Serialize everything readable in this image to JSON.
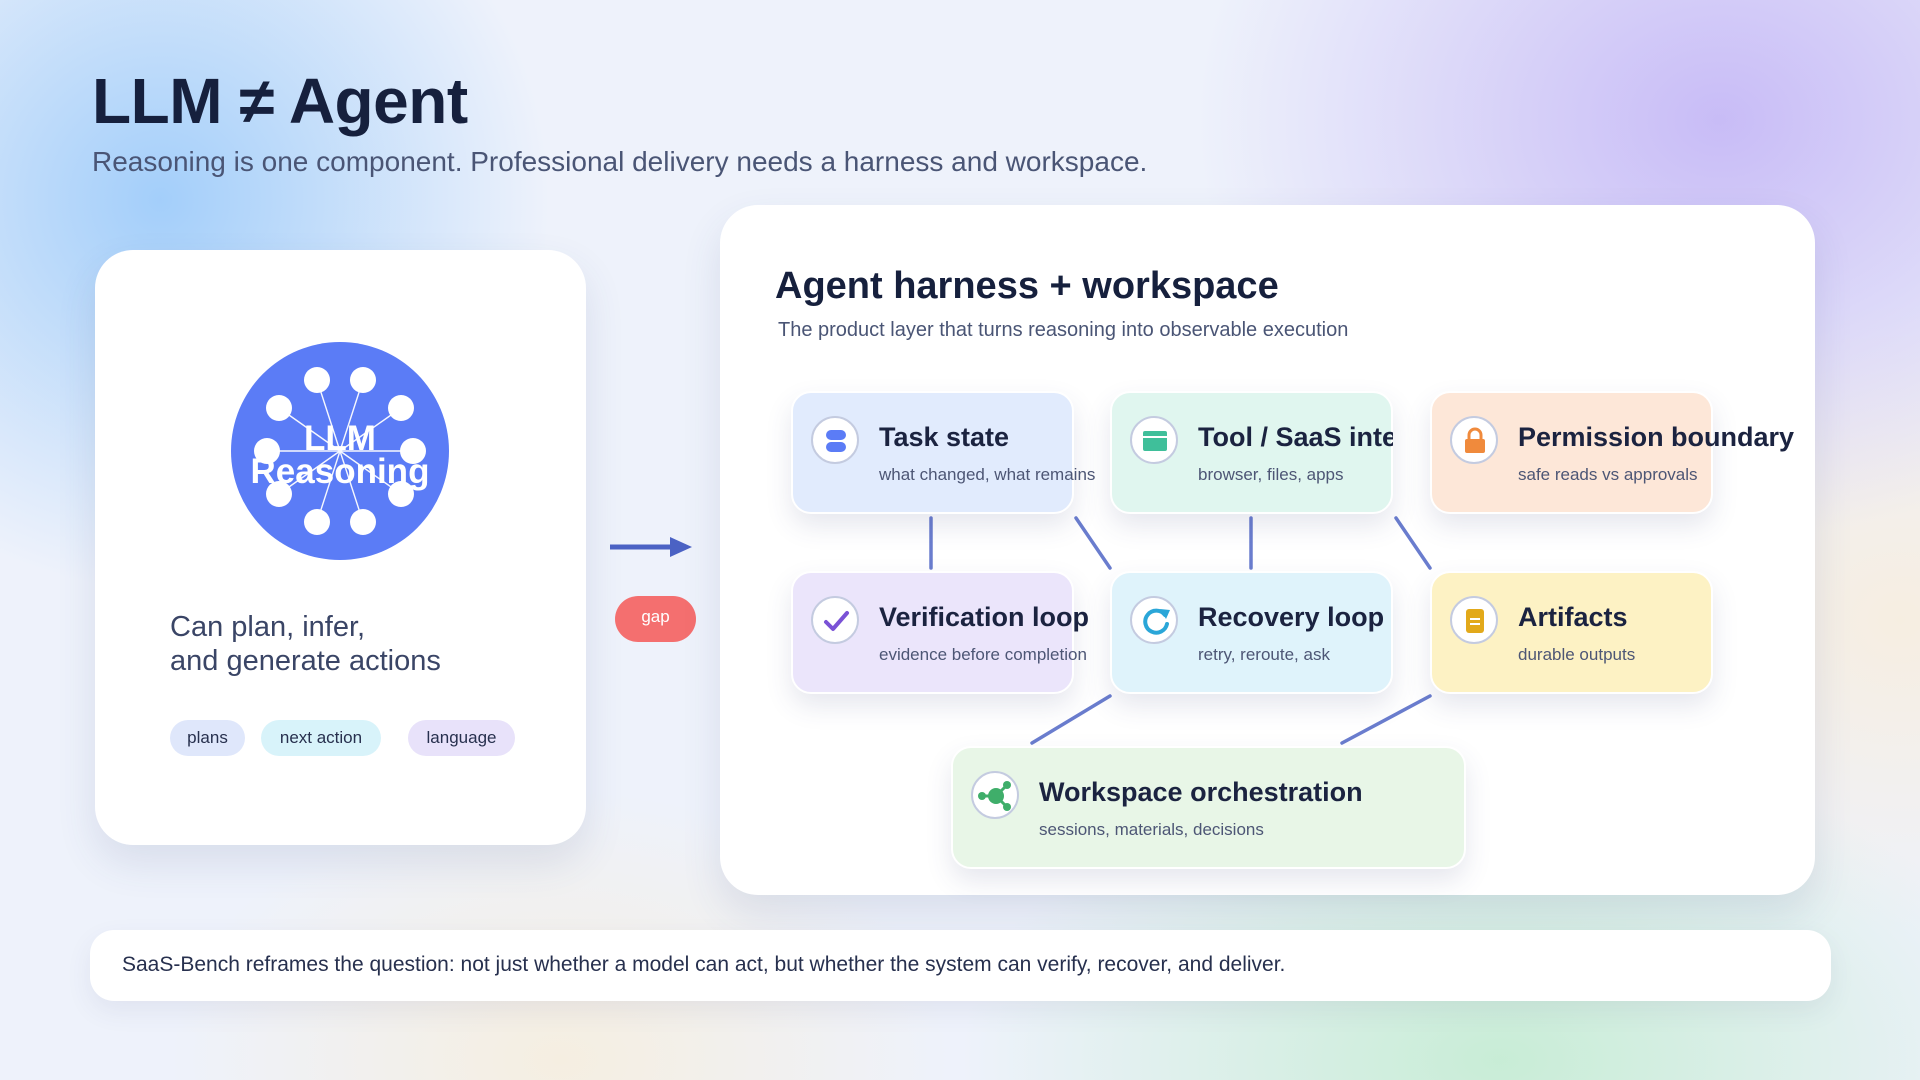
{
  "header": {
    "title": "LLM ≠ Agent",
    "subtitle": "Reasoning is one component. Professional delivery needs a harness and workspace."
  },
  "llm_panel": {
    "circle_label_line1": "LLM",
    "circle_label_line2": "Reasoning",
    "description_line1": "Can plan, infer,",
    "description_line2": "and generate actions",
    "chips": [
      "plans",
      "next action",
      "language"
    ]
  },
  "bridge": {
    "gap_label": "gap"
  },
  "harness_panel": {
    "title": "Agent harness + workspace",
    "subtitle": "The product layer that turns reasoning into observable execution",
    "nodes": [
      {
        "title": "Task state",
        "subtitle": "what changed, what remains",
        "icon": "database-icon",
        "color": "#e1ebfd"
      },
      {
        "title": "Tool / SaaS interface",
        "subtitle": "browser, files, apps",
        "icon": "browser-window-icon",
        "color": "#e0f6ef"
      },
      {
        "title": "Permission boundary",
        "subtitle": "safe reads vs approvals",
        "icon": "lock-icon",
        "color": "#fde7d8"
      },
      {
        "title": "Verification loop",
        "subtitle": "evidence before completion",
        "icon": "checkmark-icon",
        "color": "#ebe5fb"
      },
      {
        "title": "Recovery loop",
        "subtitle": "retry, reroute, ask",
        "icon": "refresh-icon",
        "color": "#dff3fb"
      },
      {
        "title": "Artifacts",
        "subtitle": "durable outputs",
        "icon": "document-icon",
        "color": "#fdf2c4"
      },
      {
        "title": "Workspace orchestration",
        "subtitle": "sessions, materials, decisions",
        "icon": "hub-icon",
        "color": "#e8f6e7"
      }
    ]
  },
  "footer": {
    "text": "SaaS-Bench reframes the question: not just whether a model can act, but whether the system can verify, recover, and deliver."
  },
  "colors": {
    "accent_blue": "#5b7cf6",
    "connector": "#5a6fc9",
    "gap_red": "#f46f6f",
    "title_dark": "#16203d"
  }
}
